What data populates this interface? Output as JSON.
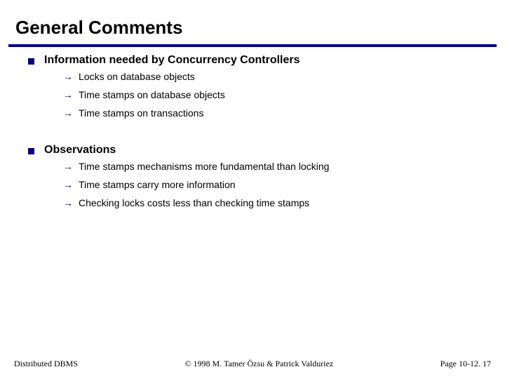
{
  "title": "General Comments",
  "sections": [
    {
      "heading": "Information needed by Concurrency Controllers",
      "items": [
        "Locks on database objects",
        "Time stamps on database objects",
        "Time stamps on transactions"
      ]
    },
    {
      "heading": "Observations",
      "items": [
        "Time stamps mechanisms more fundamental than locking",
        "Time stamps carry more information",
        "Checking locks costs less than checking time stamps"
      ]
    }
  ],
  "footer": {
    "left": "Distributed DBMS",
    "center": "© 1998 M. Tamer Özsu & Patrick Valduriez",
    "right": "Page 10-12. 17"
  },
  "glyphs": {
    "arrow": "à"
  }
}
